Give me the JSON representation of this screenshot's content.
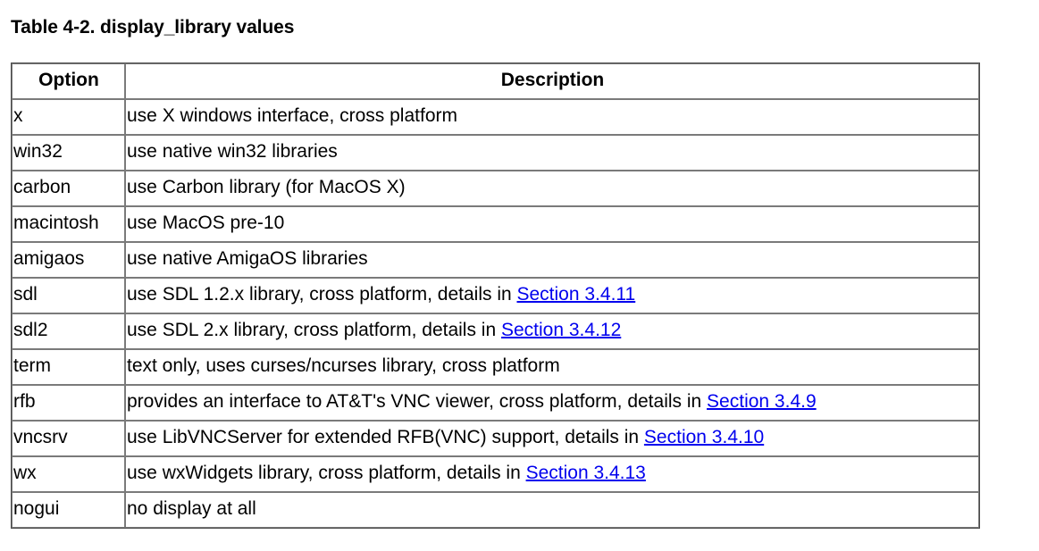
{
  "page": {
    "title": "Table 4-2. display_library values",
    "link_color": "#0000ee",
    "text_color": "#000000",
    "border_color": "#7a7a7a",
    "background_color": "#ffffff"
  },
  "table": {
    "caption": "Table 4-2. display_library values",
    "headers": {
      "option": "Option",
      "description": "Description"
    },
    "rows": [
      {
        "option": "x",
        "desc_prefix": "use X windows interface, cross platform",
        "link": null,
        "desc_suffix": ""
      },
      {
        "option": "win32",
        "desc_prefix": "use native win32 libraries",
        "link": null,
        "desc_suffix": ""
      },
      {
        "option": "carbon",
        "desc_prefix": "use Carbon library (for MacOS X)",
        "link": null,
        "desc_suffix": ""
      },
      {
        "option": "macintosh",
        "desc_prefix": "use MacOS pre-10",
        "link": null,
        "desc_suffix": ""
      },
      {
        "option": "amigaos",
        "desc_prefix": "use native AmigaOS libraries",
        "link": null,
        "desc_suffix": ""
      },
      {
        "option": "sdl",
        "desc_prefix": "use SDL 1.2.x library, cross platform, details in ",
        "link": "Section 3.4.11",
        "desc_suffix": ""
      },
      {
        "option": "sdl2",
        "desc_prefix": "use SDL 2.x library, cross platform, details in ",
        "link": "Section 3.4.12",
        "desc_suffix": ""
      },
      {
        "option": "term",
        "desc_prefix": "text only, uses curses/ncurses library, cross platform",
        "link": null,
        "desc_suffix": ""
      },
      {
        "option": "rfb",
        "desc_prefix": "provides an interface to AT&T's VNC viewer, cross platform, details in ",
        "link": "Section 3.4.9",
        "desc_suffix": ""
      },
      {
        "option": "vncsrv",
        "desc_prefix": "use LibVNCServer for extended RFB(VNC) support, details in ",
        "link": "Section 3.4.10",
        "desc_suffix": ""
      },
      {
        "option": "wx",
        "desc_prefix": "use wxWidgets library, cross platform, details in ",
        "link": "Section 3.4.13",
        "desc_suffix": ""
      },
      {
        "option": "nogui",
        "desc_prefix": "no display at all",
        "link": null,
        "desc_suffix": ""
      }
    ]
  }
}
